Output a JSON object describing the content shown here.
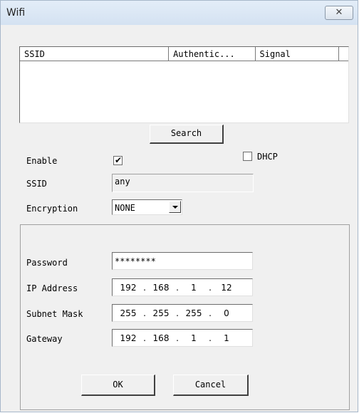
{
  "window": {
    "title": "Wifi",
    "close_glyph": "✕",
    "close_icon": "close-icon"
  },
  "list": {
    "columns": [
      "SSID",
      "Authentic...",
      "Signal",
      ""
    ]
  },
  "search_button": "Search",
  "enable": {
    "label": "Enable",
    "checked": true,
    "check_glyph": "✔"
  },
  "dhcp": {
    "label": "DHCP",
    "checked": false
  },
  "ssid": {
    "label": "SSID",
    "value": "any"
  },
  "encryption": {
    "label": "Encryption",
    "value": "NONE"
  },
  "password": {
    "label": "Password",
    "value": "********"
  },
  "ip_address": {
    "label": "IP Address",
    "octets": [
      "192",
      "168",
      "1",
      "12"
    ]
  },
  "subnet_mask": {
    "label": "Subnet Mask",
    "octets": [
      "255",
      "255",
      "255",
      "0"
    ]
  },
  "gateway": {
    "label": "Gateway",
    "octets": [
      "192",
      "168",
      "1",
      "1"
    ]
  },
  "ok_button": "OK",
  "cancel_button": "Cancel"
}
